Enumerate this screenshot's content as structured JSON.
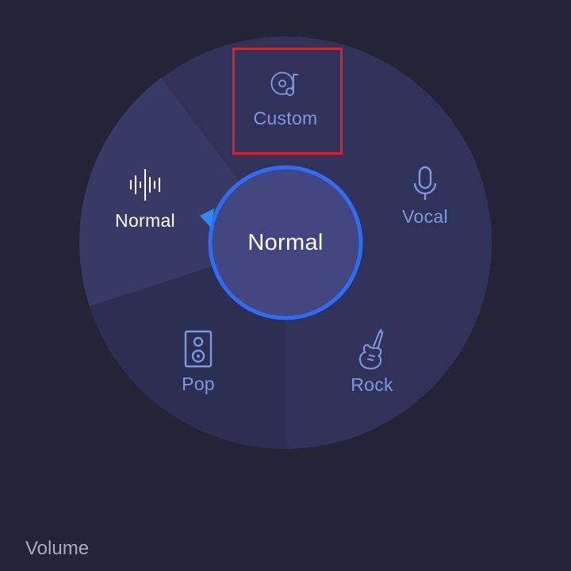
{
  "colors": {
    "background": "#242436",
    "dial": "#303259",
    "dial_selected_sector": "#383a66",
    "dial_sector_dark": "#2c2e52",
    "center_fill": "#414580",
    "center_ring": "#2f6cf5",
    "label_inactive": "#7f96e0",
    "label_active": "#ffffff",
    "highlight": "#d9232c"
  },
  "presets": [
    {
      "id": "custom",
      "label": "Custom",
      "icon": "vinyl-note-icon",
      "active": false
    },
    {
      "id": "vocal",
      "label": "Vocal",
      "icon": "microphone-icon",
      "active": false
    },
    {
      "id": "rock",
      "label": "Rock",
      "icon": "electric-guitar-icon",
      "active": false
    },
    {
      "id": "pop",
      "label": "Pop",
      "icon": "speaker-icon",
      "active": false
    },
    {
      "id": "normal",
      "label": "Normal",
      "icon": "waveform-icon",
      "active": true
    }
  ],
  "center": {
    "label": "Normal"
  },
  "footer": {
    "volume_label": "Volume"
  }
}
